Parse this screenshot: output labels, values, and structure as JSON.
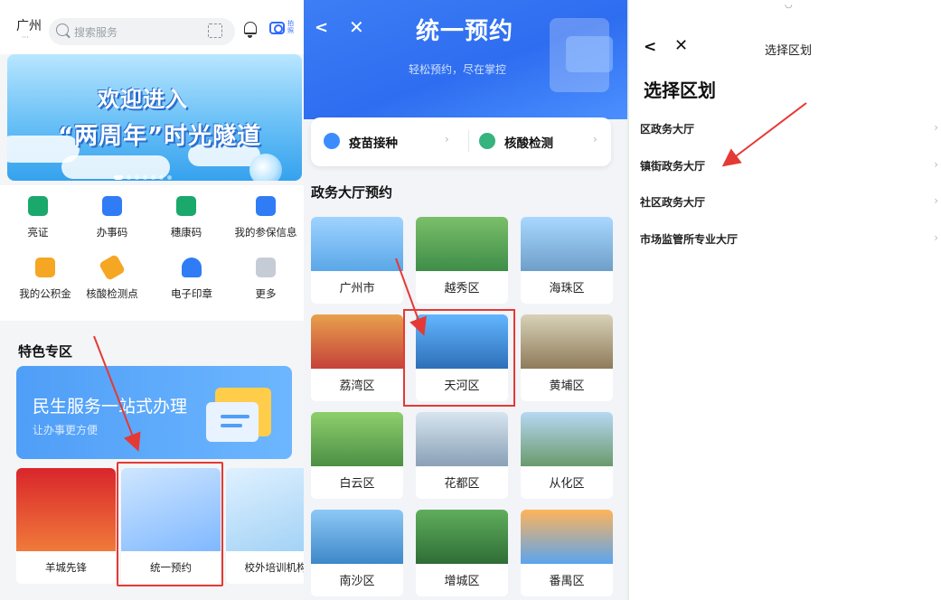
{
  "panel1": {
    "city": "广州",
    "city_sub": "···",
    "search_placeholder": "搜索服务",
    "camera_label": "拍照",
    "banner_line1": "欢迎进入",
    "banner_line2": "“两周年”时光隧道",
    "grid": [
      {
        "label": "亮证",
        "icon": "id-icon",
        "color": "#1aa86b"
      },
      {
        "label": "办事码",
        "icon": "qrcode-icon",
        "color": "#2f7cf6"
      },
      {
        "label": "穗康码",
        "icon": "health-qrcode-icon",
        "color": "#1aa86b"
      },
      {
        "label": "我的参保信息",
        "icon": "insurance-card-icon",
        "color": "#2f7cf6"
      },
      {
        "label": "我的公积金",
        "icon": "fund-icon",
        "color": "#f5a623"
      },
      {
        "label": "核酸检测点",
        "icon": "test-tube-icon",
        "color": "#f5a623"
      },
      {
        "label": "电子印章",
        "icon": "seal-icon",
        "color": "#2f7cf6"
      },
      {
        "label": "更多",
        "icon": "more-grid-icon",
        "color": "#c5ccd6"
      }
    ],
    "section_title": "特色专区",
    "special_title": "民生服务一站式办理",
    "special_sub": "让办事更方便",
    "cards": [
      {
        "label": "羊城先锋"
      },
      {
        "label": "统一预约"
      },
      {
        "label": "校外培训机构"
      }
    ]
  },
  "panel2": {
    "title": "统一预约",
    "subtitle": "轻松预约，尽在掌控",
    "quick": [
      {
        "label": "疫苗接种"
      },
      {
        "label": "核酸检测"
      }
    ],
    "section_title": "政务大厅预约",
    "districts": [
      "广州市",
      "越秀区",
      "海珠区",
      "荔湾区",
      "天河区",
      "黄埔区",
      "白云区",
      "花都区",
      "从化区",
      "南沙区",
      "增城区",
      "番禺区"
    ]
  },
  "panel3": {
    "nav_title": "选择区划",
    "heading": "选择区划",
    "rows": [
      "区政务大厅",
      "镇街政务大厅",
      "社区政务大厅",
      "市场监管所专业大厅"
    ]
  }
}
